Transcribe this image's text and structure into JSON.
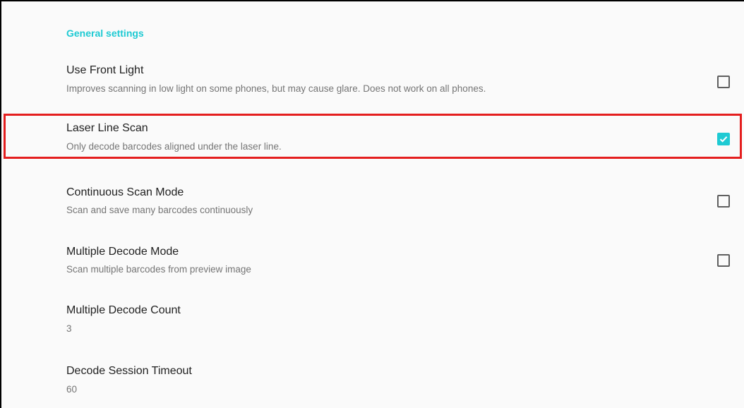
{
  "section": {
    "title": "General settings"
  },
  "settings": [
    {
      "title": "Use Front Light",
      "summary": "Improves scanning in low light on some phones, but may cause glare. Does not work on all phones.",
      "checkbox": true,
      "checked": false
    },
    {
      "title": "Laser Line Scan",
      "summary": "Only decode barcodes aligned under the laser line.",
      "checkbox": true,
      "checked": true
    },
    {
      "title": "Continuous Scan Mode",
      "summary": "Scan and save many barcodes continuously",
      "checkbox": true,
      "checked": false
    },
    {
      "title": "Multiple Decode Mode",
      "summary": "Scan multiple barcodes from preview image",
      "checkbox": true,
      "checked": false
    },
    {
      "title": "Multiple Decode Count",
      "summary": "3",
      "checkbox": false
    },
    {
      "title": "Decode Session Timeout",
      "summary": "60",
      "checkbox": false
    }
  ],
  "colors": {
    "accent": "#1ecad3",
    "highlight": "#e41e1e"
  },
  "icons": {
    "checked": "check-icon"
  }
}
